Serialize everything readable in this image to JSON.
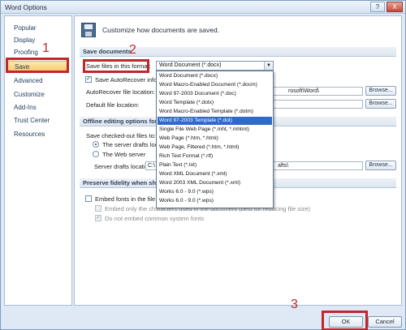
{
  "window": {
    "title": "Word Options",
    "help_btn": "?",
    "close_btn": "X"
  },
  "sidebar": {
    "items": [
      {
        "label": "Popular"
      },
      {
        "label": "Display"
      },
      {
        "label": "Proofing"
      },
      {
        "label": "Save"
      },
      {
        "label": "Advanced"
      },
      {
        "label": "Customize"
      },
      {
        "label": "Add-Ins"
      },
      {
        "label": "Trust Center"
      },
      {
        "label": "Resources"
      }
    ],
    "selected": "Save"
  },
  "annotations": {
    "step1": "1",
    "step2": "2",
    "step3": "3",
    "color": "#c0272d"
  },
  "header": {
    "text": "Customize how documents are saved."
  },
  "save_documents": {
    "title": "Save documents",
    "format_label": "Save files in this format:",
    "format_value": "Word Document (*.docx)",
    "autorecover_label": "Save AutoRecover inform",
    "autorecover_checked": true,
    "autorecover_location_label": "AutoRecover file location:",
    "autorecover_location_value": "rosoft\\Word\\",
    "default_location_label": "Default file location:",
    "browse_label": "Browse..."
  },
  "format_options": [
    "Word Document (*.docx)",
    "Word Macro-Enabled Document (*.docm)",
    "Word 97-2003 Document (*.doc)",
    "Word Template (*.dotx)",
    "Word Macro-Enabled Template (*.dotm)",
    "Word 97-2003 Template (*.dot)",
    "Single File Web Page (*.mht, *.mhtml)",
    "Web Page (*.htm, *.html)",
    "Web Page, Filtered (*.htm, *.html)",
    "Rich Text Format (*.rtf)",
    "Plain Text (*.txt)",
    "Word XML Document (*.xml)",
    "Word 2003 XML Document (*.xml)",
    "Works 6.0 - 9.0 (*.wps)",
    "Works 6.0 - 9.0 (*.wps)"
  ],
  "format_selected_index": 5,
  "offline": {
    "title": "Offline editing options for do",
    "checked_out_label": "Save checked-out files to:",
    "server_drafts_radio": "The server drafts locat",
    "web_server_radio": "The Web server",
    "server_drafts_location_label": "Server drafts location:",
    "server_drafts_value_left": "C:\\",
    "server_drafts_value_right": "afts\\",
    "browse_label": "Browse..."
  },
  "fidelity": {
    "title": "Preserve fidelity when sharin",
    "embed_fonts_label": "Embed fonts in the file",
    "embed_chars_label": "Embed only the characters used in the document (best for reducing file size)",
    "no_common_fonts_label": "Do not embed common system fonts"
  },
  "footer": {
    "ok_label": "OK",
    "cancel_label": "Cancel"
  }
}
